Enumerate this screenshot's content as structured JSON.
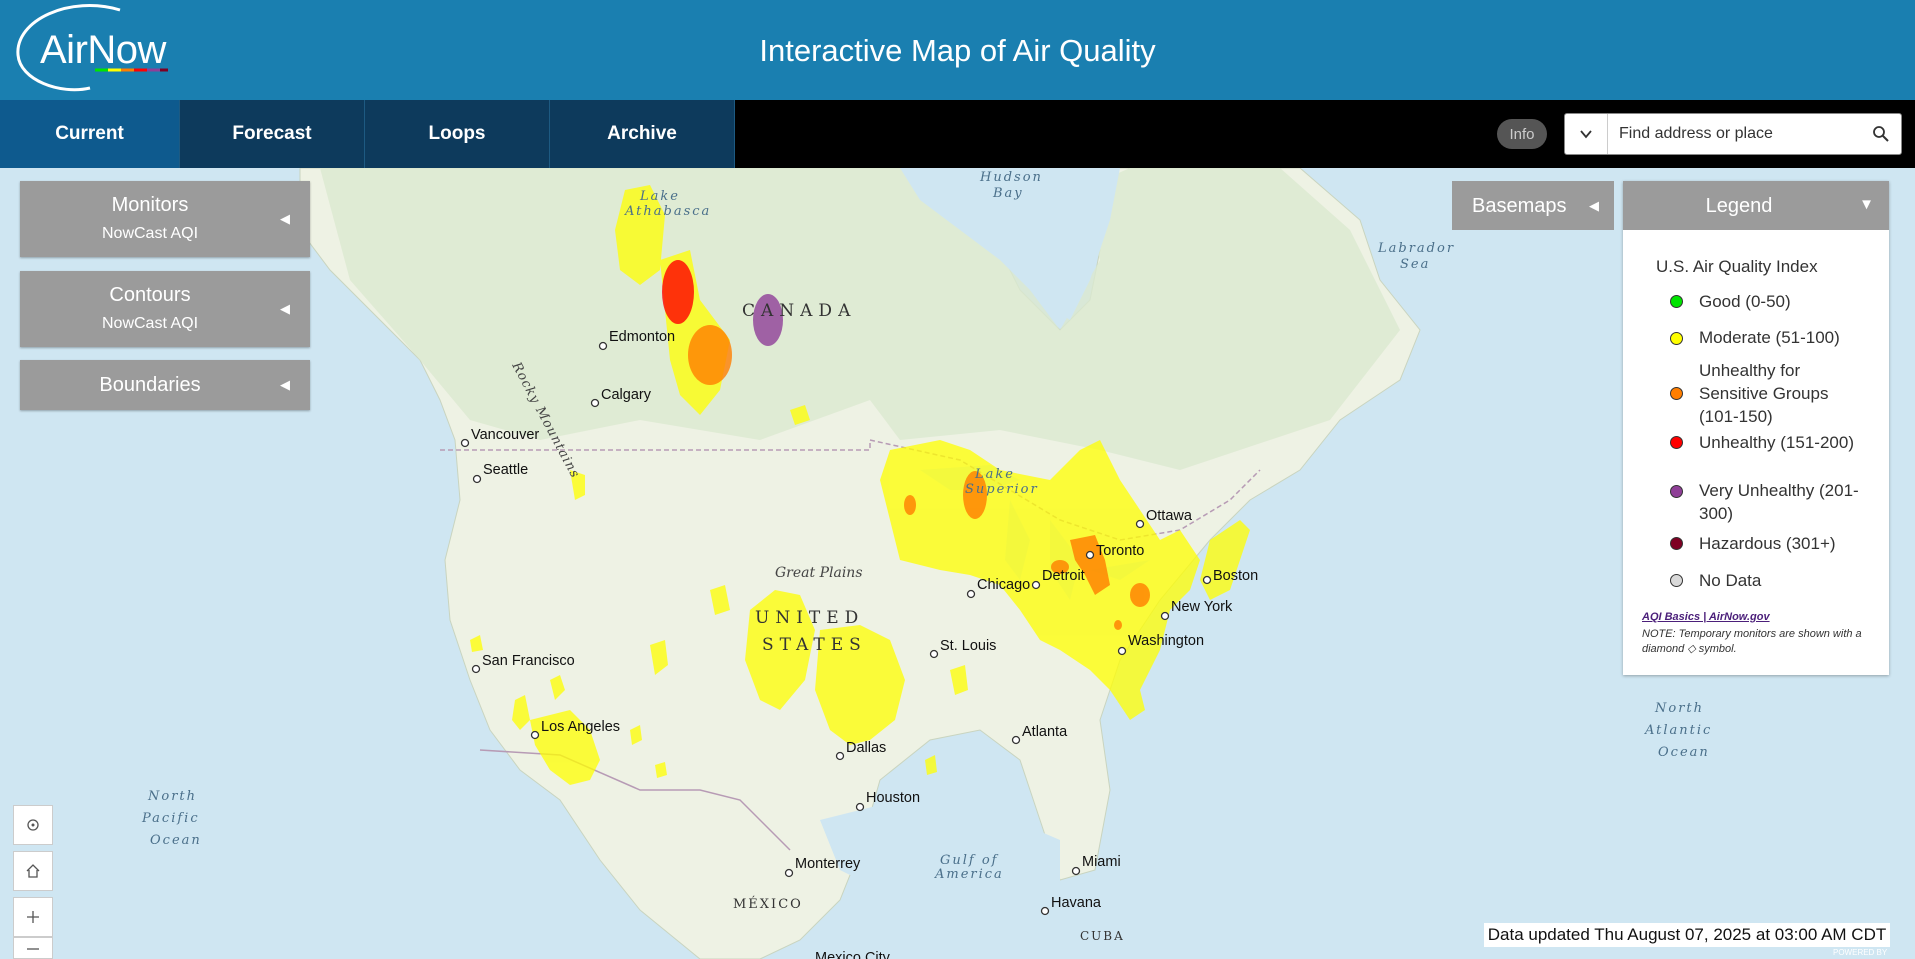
{
  "header": {
    "logo_text": "AirNow",
    "title": "Interactive Map of Air Quality"
  },
  "nav": {
    "tabs": [
      {
        "label": "Current"
      },
      {
        "label": "Forecast"
      },
      {
        "label": "Loops"
      },
      {
        "label": "Archive"
      }
    ]
  },
  "toolbar": {
    "info_label": "Info",
    "search_placeholder": "Find address or place"
  },
  "panels": {
    "monitors": {
      "title": "Monitors",
      "subtitle": "NowCast AQI"
    },
    "contours": {
      "title": "Contours",
      "subtitle": "NowCast AQI"
    },
    "boundaries": {
      "title": "Boundaries"
    }
  },
  "basemaps": {
    "label": "Basemaps"
  },
  "legend": {
    "header": "Legend",
    "title": "U.S. Air Quality Index",
    "items": [
      {
        "label": "Good (0-50)",
        "color": "#00e400"
      },
      {
        "label": "Moderate (51-100)",
        "color": "#ffff00"
      },
      {
        "label": "Unhealthy for Sensitive Groups (101-150)",
        "color": "#ff7e00"
      },
      {
        "label": "Unhealthy (151-200)",
        "color": "#ff0000"
      },
      {
        "label": "Very Unhealthy (201-300)",
        "color": "#8f3f97"
      },
      {
        "label": "Hazardous (301+)",
        "color": "#7e0023"
      },
      {
        "label": "No Data",
        "color": "#d9d9d9"
      }
    ],
    "link": "AQI Basics | AirNow.gov",
    "note": "NOTE: Temporary monitors are shown with a diamond ◇ symbol."
  },
  "map": {
    "cities": [
      {
        "name": "Edmonton"
      },
      {
        "name": "Calgary"
      },
      {
        "name": "Vancouver"
      },
      {
        "name": "Seattle"
      },
      {
        "name": "San Francisco"
      },
      {
        "name": "Los Angeles"
      },
      {
        "name": "Dallas"
      },
      {
        "name": "Houston"
      },
      {
        "name": "Monterrey"
      },
      {
        "name": "St. Louis"
      },
      {
        "name": "Chicago"
      },
      {
        "name": "Detroit"
      },
      {
        "name": "Toronto"
      },
      {
        "name": "Ottawa"
      },
      {
        "name": "Boston"
      },
      {
        "name": "New York"
      },
      {
        "name": "Washington"
      },
      {
        "name": "Atlanta"
      },
      {
        "name": "Miami"
      },
      {
        "name": "Havana"
      },
      {
        "name": "Mexico City"
      }
    ],
    "countries": {
      "canada": "CANADA",
      "us_line1": "UNITED",
      "us_line2": "STATES",
      "mexico": "MÉXICO",
      "cuba": "CUBA"
    },
    "regions": {
      "great_plains": "Great Plains",
      "rocky_mountains": "Rocky Mountains"
    },
    "water": {
      "lake_athabasca_1": "Lake",
      "lake_athabasca_2": "Athabasca",
      "hudson_bay_1": "Hudson",
      "hudson_bay_2": "Bay",
      "labrador_sea_1": "Labrador",
      "labrador_sea_2": "Sea",
      "lake_superior_1": "Lake",
      "lake_superior_2": "Superior",
      "gulf_mexico_1": "Gulf of",
      "gulf_mexico_2": "America",
      "north_pacific_1": "North",
      "north_pacific_2": "Pacific",
      "north_pacific_3": "Ocean",
      "north_atlantic_1": "North",
      "north_atlantic_2": "Atlantic",
      "north_atlantic_3": "Ocean"
    }
  },
  "status": {
    "data_updated": "Data updated Thu August 07, 2025 at 03:00 AM CDT",
    "powered_by": "POWERED BY"
  }
}
